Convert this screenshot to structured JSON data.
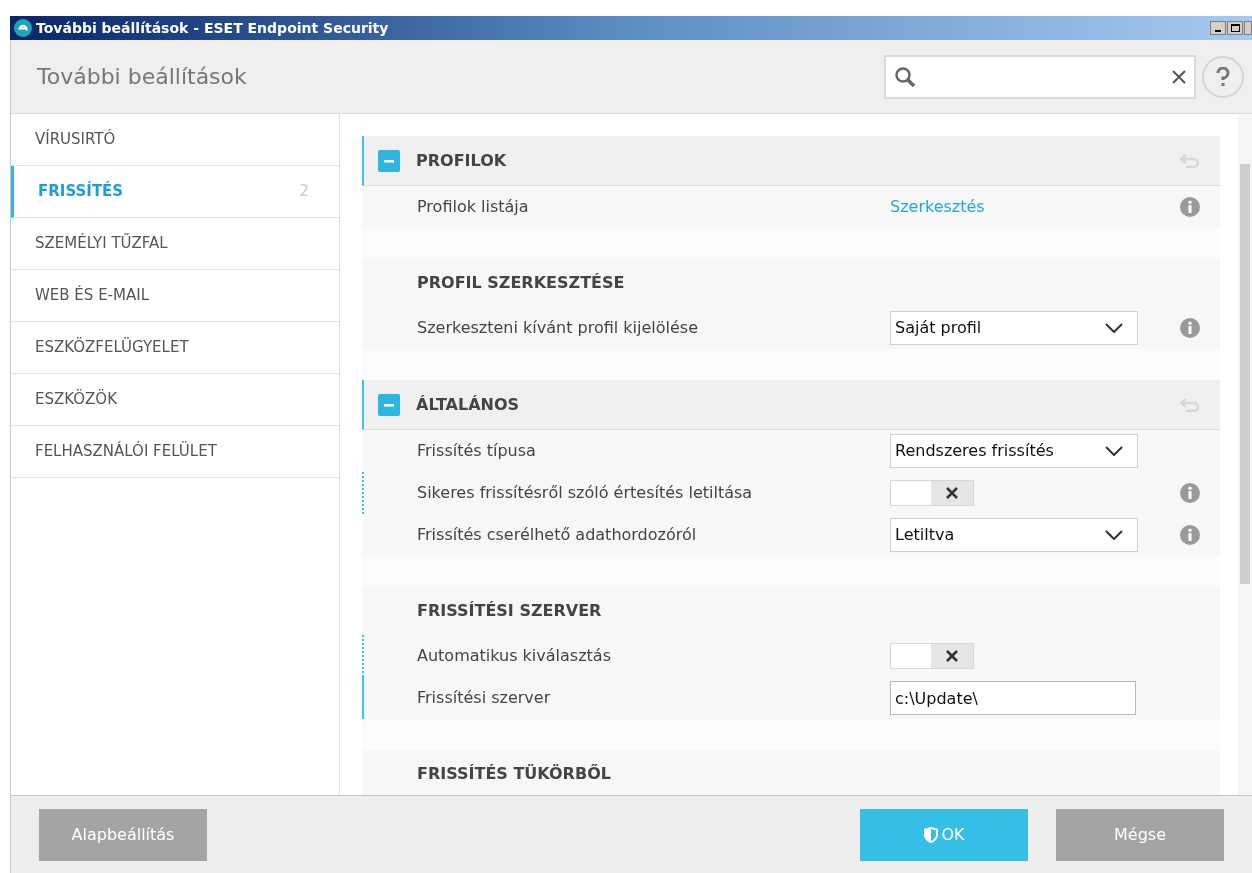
{
  "window": {
    "title": "További beállítások - ESET Endpoint Security"
  },
  "header": {
    "title": "További beállítások"
  },
  "sidebar": {
    "items": [
      {
        "label": "VÍRUSIRTÓ",
        "selected": false
      },
      {
        "label": "FRISSÍTÉS",
        "selected": true,
        "count": "2"
      },
      {
        "label": "SZEMÉLYI TŰZFAL",
        "selected": false
      },
      {
        "label": "WEB ÉS E-MAIL",
        "selected": false
      },
      {
        "label": "ESZKÖZFELÜGYELET",
        "selected": false
      },
      {
        "label": "ESZKÖZÖK",
        "selected": false
      },
      {
        "label": "FELHASZNÁLÓI FELÜLET",
        "selected": false
      }
    ]
  },
  "content": [
    {
      "kind": "section",
      "title": "PROFILOK",
      "expanded": true
    },
    {
      "kind": "link",
      "label": "Profilok listája",
      "value": "Szerkesztés",
      "info": true
    },
    {
      "kind": "gap"
    },
    {
      "kind": "subsection",
      "title": "PROFIL SZERKESZTÉSE"
    },
    {
      "kind": "select",
      "label": "Szerkeszteni kívánt profil kijelölése",
      "value": "Saját profil",
      "info": true
    },
    {
      "kind": "gap"
    },
    {
      "kind": "section",
      "title": "ÁLTALÁNOS",
      "expanded": true
    },
    {
      "kind": "select",
      "label": "Frissítés típusa",
      "value": "Rendszeres frissítés",
      "info": false
    },
    {
      "kind": "toggle",
      "label": "Sikeres frissítésről szóló értesítés letiltása",
      "on": false,
      "info": true,
      "changed": true
    },
    {
      "kind": "select",
      "label": "Frissítés cserélhető adathordozóról",
      "value": "Letiltva",
      "info": true
    },
    {
      "kind": "gap"
    },
    {
      "kind": "subsection",
      "title": "FRISSÍTÉSI SZERVER"
    },
    {
      "kind": "toggle",
      "label": "Automatikus kiválasztás",
      "on": false,
      "info": false,
      "changed": true
    },
    {
      "kind": "input",
      "label": "Frissítési szerver",
      "value": "c:\\Update\\",
      "info": false,
      "focused": true
    },
    {
      "kind": "gap"
    },
    {
      "kind": "subsection",
      "title": "FRISSÍTÉS TÜKÖRBŐL"
    }
  ],
  "footer": {
    "buttons": [
      {
        "label": "Alapbeállítás",
        "kind": "default"
      },
      {
        "label": "OK",
        "kind": "primary"
      },
      {
        "label": "Mégse",
        "kind": "default"
      }
    ]
  }
}
